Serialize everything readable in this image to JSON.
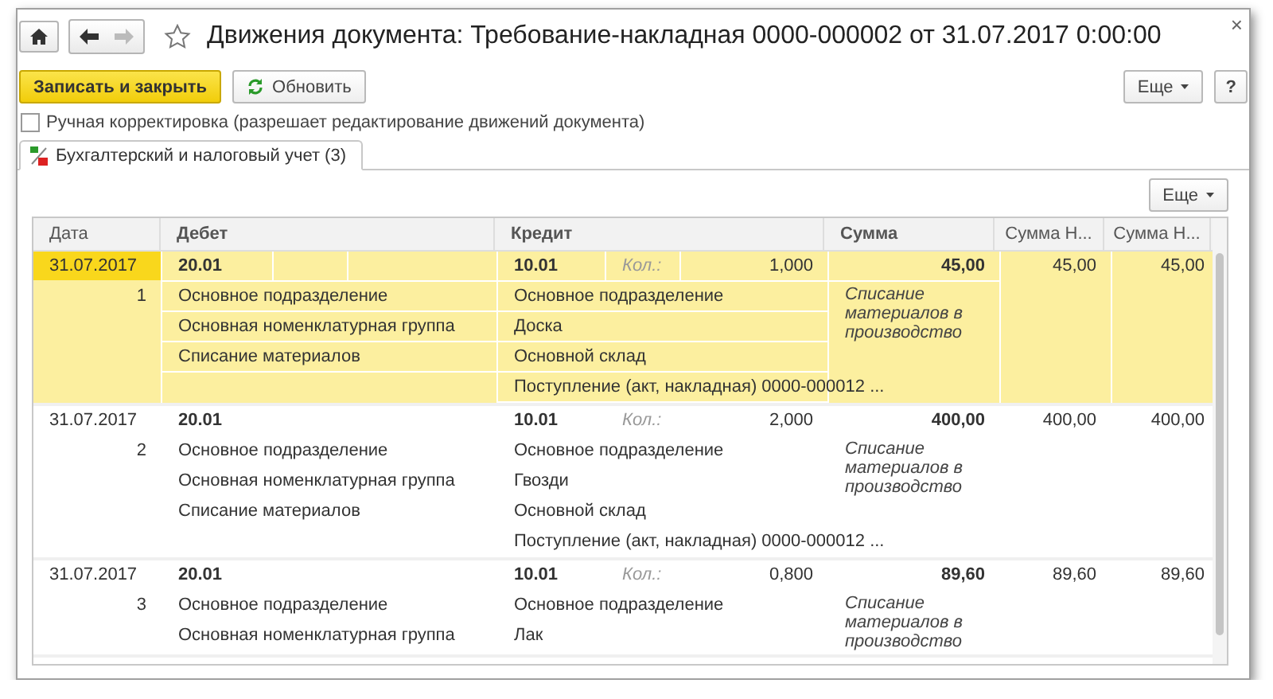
{
  "window": {
    "title": "Движения документа: Требование-накладная 0000-000002 от 31.07.2017 0:00:00",
    "close": "×"
  },
  "toolbar": {
    "primary": "Записать и закрыть",
    "refresh": "Обновить",
    "more": "Еще",
    "help": "?"
  },
  "manual_edit": {
    "label": "Ручная корректировка (разрешает редактирование движений документа)",
    "checked": false
  },
  "tabs": [
    {
      "label": "Бухгалтерский и налоговый учет (3)",
      "selected": true
    }
  ],
  "table_toolbar": {
    "more": "Еще"
  },
  "table": {
    "columns": [
      "Дата",
      "Дебет",
      "Кредит",
      "Сумма",
      "Сумма Н...",
      "Сумма Н..."
    ],
    "rows": [
      {
        "selected": true,
        "date": "31.07.2017",
        "number": "1",
        "debit": {
          "account": "20.01",
          "lines": [
            "Основное подразделение",
            "Основная номенклатурная группа",
            "Списание материалов"
          ]
        },
        "credit": {
          "account": "10.01",
          "qty_label": "Кол.:",
          "qty": "1,000",
          "lines": [
            "Основное подразделение",
            "Доска",
            "Основной склад",
            "Поступление (акт, накладная) 0000-000012 ..."
          ]
        },
        "sum": "45,00",
        "sum_note": "Списание материалов в производство",
        "sum_n1": "45,00",
        "sum_n2": "45,00"
      },
      {
        "selected": false,
        "date": "31.07.2017",
        "number": "2",
        "debit": {
          "account": "20.01",
          "lines": [
            "Основное подразделение",
            "Основная номенклатурная группа",
            "Списание материалов"
          ]
        },
        "credit": {
          "account": "10.01",
          "qty_label": "Кол.:",
          "qty": "2,000",
          "lines": [
            "Основное подразделение",
            "Гвозди",
            "Основной склад",
            "Поступление (акт, накладная) 0000-000012 ..."
          ]
        },
        "sum": "400,00",
        "sum_note": "Списание материалов в производство",
        "sum_n1": "400,00",
        "sum_n2": "400,00"
      },
      {
        "selected": false,
        "date": "31.07.2017",
        "number": "3",
        "debit": {
          "account": "20.01",
          "lines": [
            "Основное подразделение",
            "Основная номенклатурная группа"
          ]
        },
        "credit": {
          "account": "10.01",
          "qty_label": "Кол.:",
          "qty": "0,800",
          "lines": [
            "Основное подразделение",
            "Лак"
          ]
        },
        "sum": "89,60",
        "sum_note": "Списание материалов в производство",
        "sum_n1": "89,60",
        "sum_n2": "89,60"
      }
    ]
  }
}
